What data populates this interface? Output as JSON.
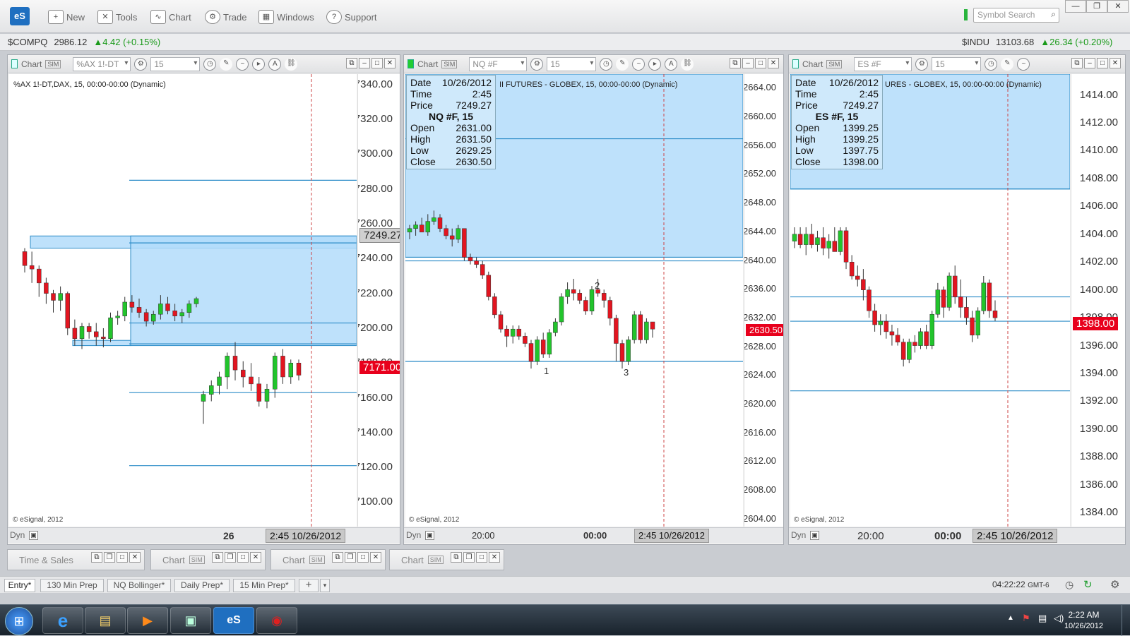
{
  "app": {
    "logo": "eS"
  },
  "toolbar": {
    "items": [
      {
        "label": "New",
        "icon": "new-window-icon"
      },
      {
        "label": "Tools",
        "icon": "tools-icon"
      },
      {
        "label": "Chart",
        "icon": "chart-icon"
      },
      {
        "label": "Trade",
        "icon": "trade-icon"
      },
      {
        "label": "Windows",
        "icon": "windows-icon"
      },
      {
        "label": "Support",
        "icon": "help-icon"
      }
    ],
    "search_placeholder": "Symbol Search"
  },
  "quotes": {
    "left": {
      "symbol": "$COMPQ",
      "last": "2986.12",
      "change": "▲4.42 (+0.15%)"
    },
    "right": {
      "symbol": "$INDU",
      "last": "13103.68",
      "change": "▲26.34 (+0.20%)"
    }
  },
  "colors": {
    "up": "#22c42c",
    "down": "#e21520",
    "zone": "#b3dcfa",
    "line": "#2a8bc7"
  },
  "charts": [
    {
      "header": "Chart",
      "badge": "SIM",
      "symbol": "%AX 1!-DT",
      "interval": "15",
      "title": "%AX 1!-DT,DAX, 15, 00:00-00:00 (Dynamic)",
      "copyright": "© eSignal, 2012",
      "foot_left": "Dyn",
      "foot_date": "26",
      "timestamp": "2:45 10/26/2012",
      "price_tag": "7171.00",
      "cursor_tag": "7249.27",
      "chart_data": {
        "type": "candlestick",
        "ylim": [
          7086,
          7346
        ],
        "yticks": [
          "7340.00",
          "7320.00",
          "7300.00",
          "7280.00",
          "7260.00",
          "7240.00",
          "7220.00",
          "7200.00",
          "7180.00",
          "7160.00",
          "7140.00",
          "7120.00",
          "7100.00"
        ],
        "hlines": [
          7285,
          7249,
          7203,
          7191,
          7163,
          7121
        ],
        "candles": [
          [
            7244,
            7246,
            7232,
            7236
          ],
          [
            7236,
            7244,
            7226,
            7234
          ],
          [
            7234,
            7236,
            7218,
            7226
          ],
          [
            7226,
            7229,
            7214,
            7220
          ],
          [
            7220,
            7222,
            7209,
            7216
          ],
          [
            7216,
            7224,
            7210,
            7220
          ],
          [
            7220,
            7221,
            7196,
            7200
          ],
          [
            7200,
            7205,
            7190,
            7194
          ],
          [
            7194,
            7203,
            7188,
            7201
          ],
          [
            7201,
            7203,
            7194,
            7198
          ],
          [
            7198,
            7203,
            7190,
            7195
          ],
          [
            7195,
            7200,
            7189,
            7194
          ],
          [
            7194,
            7209,
            7192,
            7206
          ],
          [
            7206,
            7210,
            7202,
            7207
          ],
          [
            7207,
            7218,
            7204,
            7215
          ],
          [
            7215,
            7219,
            7209,
            7212
          ],
          [
            7212,
            7217,
            7206,
            7209
          ],
          [
            7209,
            7211,
            7201,
            7204
          ],
          [
            7204,
            7210,
            7202,
            7208
          ],
          [
            7208,
            7219,
            7205,
            7214
          ],
          [
            7214,
            7218,
            7208,
            7210
          ],
          [
            7210,
            7214,
            7204,
            7207
          ],
          [
            7207,
            7211,
            7203,
            7209
          ],
          [
            7209,
            7216,
            7206,
            7214
          ],
          [
            7214,
            7218,
            7212,
            7217
          ],
          [
            7158,
            7164,
            7145,
            7162
          ],
          [
            7162,
            7170,
            7158,
            7167
          ],
          [
            7167,
            7175,
            7162,
            7172
          ],
          [
            7172,
            7186,
            7165,
            7184
          ],
          [
            7184,
            7192,
            7170,
            7176
          ],
          [
            7176,
            7181,
            7166,
            7172
          ],
          [
            7172,
            7180,
            7164,
            7168
          ],
          [
            7168,
            7172,
            7155,
            7158
          ],
          [
            7158,
            7168,
            7154,
            7165
          ],
          [
            7165,
            7186,
            7160,
            7184
          ],
          [
            7184,
            7188,
            7168,
            7172
          ],
          [
            7172,
            7182,
            7168,
            7180
          ],
          [
            7180,
            7182,
            7170,
            7173
          ]
        ]
      }
    },
    {
      "header": "Chart",
      "badge": "SIM",
      "symbol": "NQ #F",
      "interval": "15",
      "title": "II FUTURES - GLOBEX, 15, 00:00-00:00 (Dynamic)",
      "copyright": "© eSignal, 2012",
      "foot_left": "Dyn",
      "xlabels": [
        "20:00",
        "00:00"
      ],
      "timestamp": "2:45 10/26/2012",
      "price_tag": "2630.50",
      "info": {
        "date": "10/26/2012",
        "time": "2:45",
        "price": "7249.27",
        "series": "NQ #F, 15",
        "open": "2631.00",
        "high": "2631.50",
        "low": "2629.25",
        "close": "2630.50"
      },
      "labels": [
        "1",
        "2",
        "3"
      ],
      "chart_data": {
        "type": "candlestick",
        "ylim": [
          2603,
          2666
        ],
        "yticks": [
          "2664.00",
          "2660.00",
          "2656.00",
          "2652.00",
          "2648.00",
          "2644.00",
          "2640.00",
          "2636.00",
          "2632.00",
          "2628.00",
          "2624.00",
          "2620.00",
          "2616.00",
          "2612.00",
          "2608.00",
          "2604.00"
        ],
        "hlines": [
          2657,
          2640.5,
          2640,
          2626
        ],
        "candles": [
          [
            2644,
            2645,
            2643,
            2644.5
          ],
          [
            2644.5,
            2645.5,
            2643.5,
            2645
          ],
          [
            2645,
            2646,
            2644,
            2644
          ],
          [
            2644,
            2646.5,
            2643.5,
            2645.5
          ],
          [
            2645.5,
            2647,
            2645,
            2646
          ],
          [
            2646,
            2646.5,
            2644,
            2644.5
          ],
          [
            2644.5,
            2645,
            2643,
            2643.5
          ],
          [
            2643.5,
            2644.5,
            2642,
            2643
          ],
          [
            2643,
            2645,
            2642.5,
            2644.5
          ],
          [
            2644.5,
            2644.5,
            2640,
            2640.5
          ],
          [
            2640.5,
            2641,
            2639.5,
            2640
          ],
          [
            2640,
            2640.5,
            2639,
            2639.5
          ],
          [
            2639.5,
            2640,
            2637.5,
            2638
          ],
          [
            2638,
            2638.5,
            2634.5,
            2635
          ],
          [
            2635,
            2635.5,
            2632,
            2632.5
          ],
          [
            2632.5,
            2633,
            2630,
            2630.5
          ],
          [
            2630.5,
            2631,
            2628,
            2629.5
          ],
          [
            2629.5,
            2631,
            2628.5,
            2630.5
          ],
          [
            2630.5,
            2631,
            2629,
            2629.5
          ],
          [
            2629.5,
            2630,
            2628,
            2628.5
          ],
          [
            2628.5,
            2629,
            2625,
            2626
          ],
          [
            2626,
            2629.5,
            2625.5,
            2629
          ],
          [
            2629,
            2630,
            2626.5,
            2627
          ],
          [
            2627,
            2630.5,
            2626.5,
            2630
          ],
          [
            2630,
            2632,
            2629.5,
            2631.5
          ],
          [
            2631.5,
            2635.5,
            2631,
            2635
          ],
          [
            2635,
            2637,
            2634,
            2636
          ],
          [
            2636,
            2637.5,
            2634.5,
            2635.5
          ],
          [
            2635.5,
            2636,
            2634,
            2634.5
          ],
          [
            2634.5,
            2635,
            2632.5,
            2633
          ],
          [
            2633,
            2636.5,
            2632.5,
            2636
          ],
          [
            2636,
            2637.5,
            2635,
            2635.5
          ],
          [
            2635.5,
            2636,
            2633.5,
            2634.5
          ],
          [
            2634.5,
            2635,
            2631,
            2632
          ],
          [
            2632,
            2632.5,
            2626,
            2628.5
          ],
          [
            2628.5,
            2629,
            2625,
            2626
          ],
          [
            2626,
            2629.5,
            2625.5,
            2629
          ],
          [
            2629,
            2633,
            2628.5,
            2632.5
          ],
          [
            2632.5,
            2633,
            2628.5,
            2629
          ],
          [
            2629,
            2632,
            2628.5,
            2631.5
          ],
          [
            2631.5,
            2631.5,
            2629.3,
            2630.5
          ]
        ]
      }
    },
    {
      "header": "Chart",
      "badge": "SIM",
      "symbol": "ES #F",
      "interval": "15",
      "title": "URES - GLOBEX, 15, 00:00-00:00 (Dynamic)",
      "copyright": "© eSignal, 2012",
      "foot_left": "Dyn",
      "xlabels": [
        "20:00",
        "00:00"
      ],
      "timestamp": "2:45 10/26/2012",
      "price_tag": "1398.00",
      "info": {
        "date": "10/26/2012",
        "time": "2:45",
        "price": "7249.27",
        "series": "ES #F, 15",
        "open": "1399.25",
        "high": "1399.25",
        "low": "1397.75",
        "close": "1398.00"
      },
      "chart_data": {
        "type": "candlestick",
        "ylim": [
          1383,
          1415.5
        ],
        "yticks": [
          "1414.00",
          "1412.00",
          "1410.00",
          "1408.00",
          "1406.00",
          "1404.00",
          "1402.00",
          "1400.00",
          "1398.00",
          "1396.00",
          "1394.00",
          "1392.00",
          "1390.00",
          "1388.00",
          "1386.00",
          "1384.00"
        ],
        "hlines": [
          1407.25,
          1399.5,
          1397.75,
          1392.75
        ],
        "candles": [
          [
            1403.5,
            1404.5,
            1403,
            1404
          ],
          [
            1404,
            1404.5,
            1403,
            1403.25
          ],
          [
            1403.25,
            1404.5,
            1402.5,
            1404
          ],
          [
            1404,
            1404.75,
            1403,
            1403.25
          ],
          [
            1403.25,
            1404.25,
            1402.75,
            1403.75
          ],
          [
            1403.75,
            1404.5,
            1402.5,
            1403
          ],
          [
            1403,
            1404,
            1402.25,
            1403.5
          ],
          [
            1403.5,
            1404.5,
            1402.75,
            1402.75
          ],
          [
            1402.75,
            1404.5,
            1402.5,
            1404.25
          ],
          [
            1404.25,
            1404.5,
            1401.5,
            1402
          ],
          [
            1402,
            1402.5,
            1400.75,
            1401
          ],
          [
            1401,
            1401.75,
            1400.25,
            1400.75
          ],
          [
            1400.75,
            1401.5,
            1399.25,
            1400
          ],
          [
            1400,
            1400.25,
            1398,
            1398.5
          ],
          [
            1398.5,
            1399,
            1397,
            1397.5
          ],
          [
            1397.5,
            1398.25,
            1396.75,
            1397.75
          ],
          [
            1397.75,
            1398.25,
            1396.5,
            1397
          ],
          [
            1397,
            1397.5,
            1396,
            1396.75
          ],
          [
            1396.75,
            1397.25,
            1396,
            1396.25
          ],
          [
            1396.25,
            1396.5,
            1394.5,
            1395
          ],
          [
            1395,
            1396.5,
            1394.75,
            1396.25
          ],
          [
            1396.25,
            1396.75,
            1395.5,
            1396
          ],
          [
            1396,
            1397.25,
            1395.75,
            1397
          ],
          [
            1397,
            1397.5,
            1395.75,
            1396
          ],
          [
            1396,
            1398.5,
            1395.75,
            1398.25
          ],
          [
            1398.25,
            1400.5,
            1398,
            1400
          ],
          [
            1400,
            1400.25,
            1398,
            1398.75
          ],
          [
            1398.75,
            1401.25,
            1398.5,
            1401
          ],
          [
            1401,
            1401.75,
            1399,
            1399.5
          ],
          [
            1399.5,
            1400.75,
            1398,
            1398.75
          ],
          [
            1398.75,
            1399.5,
            1397.5,
            1398
          ],
          [
            1398,
            1398.5,
            1396.25,
            1396.75
          ],
          [
            1396.75,
            1398.75,
            1396.5,
            1398.5
          ],
          [
            1398.5,
            1401,
            1398.25,
            1400.5
          ],
          [
            1400.5,
            1400.75,
            1398,
            1398.5
          ],
          [
            1398.5,
            1399.25,
            1397.75,
            1398
          ]
        ]
      }
    }
  ],
  "minis": [
    {
      "label": "Time & Sales"
    },
    {
      "label": "Chart",
      "badge": "SIM"
    },
    {
      "label": "Chart",
      "badge": "SIM"
    },
    {
      "label": "Chart",
      "badge": "SIM"
    }
  ],
  "tabs": [
    "Entry*",
    "130 Min Prep",
    "NQ Bollinger*",
    "Daily Prep*",
    "15 Min Prep*"
  ],
  "statusbar": {
    "time": "04:22:22",
    "tz": "GMT-6"
  },
  "taskbar": {
    "time": "2:22 AM",
    "date": "10/26/2012"
  }
}
